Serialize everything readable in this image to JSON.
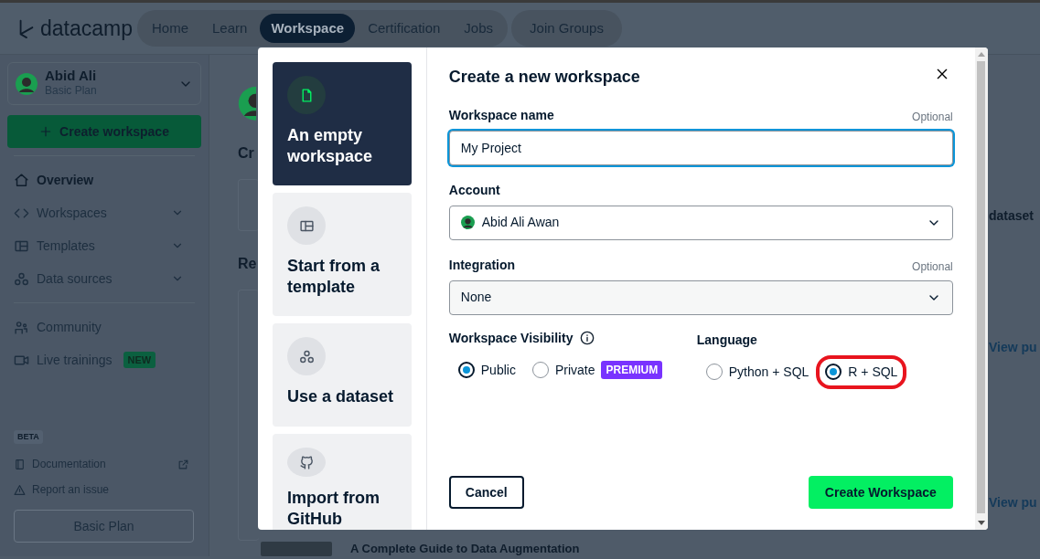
{
  "nav": {
    "logo": "datacamp",
    "tabs": [
      {
        "label": "Home",
        "selected": false
      },
      {
        "label": "Learn",
        "selected": false
      },
      {
        "label": "Workspace",
        "selected": true
      },
      {
        "label": "Certification",
        "selected": false
      },
      {
        "label": "Jobs",
        "selected": false
      }
    ],
    "extra_tab": "Join Groups"
  },
  "sidebar": {
    "user": {
      "name": "Abid Ali",
      "plan": "Basic Plan"
    },
    "create_button": "Create workspace",
    "items": [
      {
        "label": "Overview",
        "selected": true,
        "expandable": false
      },
      {
        "label": "Workspaces",
        "selected": false,
        "expandable": true
      },
      {
        "label": "Templates",
        "selected": false,
        "expandable": true
      },
      {
        "label": "Data sources",
        "selected": false,
        "expandable": true
      }
    ],
    "community_items": [
      {
        "label": "Community"
      },
      {
        "label": "Live trainings",
        "badge": "NEW"
      }
    ],
    "beta_label": "BETA",
    "links": [
      {
        "label": "Documentation",
        "external": true
      },
      {
        "label": "Report an issue",
        "external": false
      }
    ],
    "plan_button": "Basic Plan"
  },
  "background": {
    "headings": [
      "Cr",
      "Re"
    ],
    "right_texts": [
      "dataset",
      "View pu",
      "View pu"
    ],
    "bottom_title": "A Complete Guide to Data Augmentation"
  },
  "modal": {
    "options": [
      {
        "title": "An empty workspace",
        "selected": true
      },
      {
        "title": "Start from a template",
        "selected": false
      },
      {
        "title": "Use a dataset",
        "selected": false
      },
      {
        "title": "Import from GitHub",
        "selected": false
      }
    ],
    "title": "Create a new workspace",
    "name_field": {
      "label": "Workspace name",
      "note": "Optional",
      "value": "My Project"
    },
    "account_field": {
      "label": "Account",
      "value": "Abid Ali Awan"
    },
    "integration_field": {
      "label": "Integration",
      "note": "Optional",
      "value": "None"
    },
    "visibility": {
      "label": "Workspace Visibility",
      "options": [
        {
          "label": "Public",
          "selected": true
        },
        {
          "label": "Private",
          "selected": false,
          "badge": "PREMIUM"
        }
      ]
    },
    "language": {
      "label": "Language",
      "options": [
        {
          "label": "Python + SQL",
          "selected": false,
          "highlighted": false
        },
        {
          "label": "R + SQL",
          "selected": true,
          "highlighted": true
        }
      ]
    },
    "cancel_button": "Cancel",
    "submit_button": "Create Workspace"
  }
}
